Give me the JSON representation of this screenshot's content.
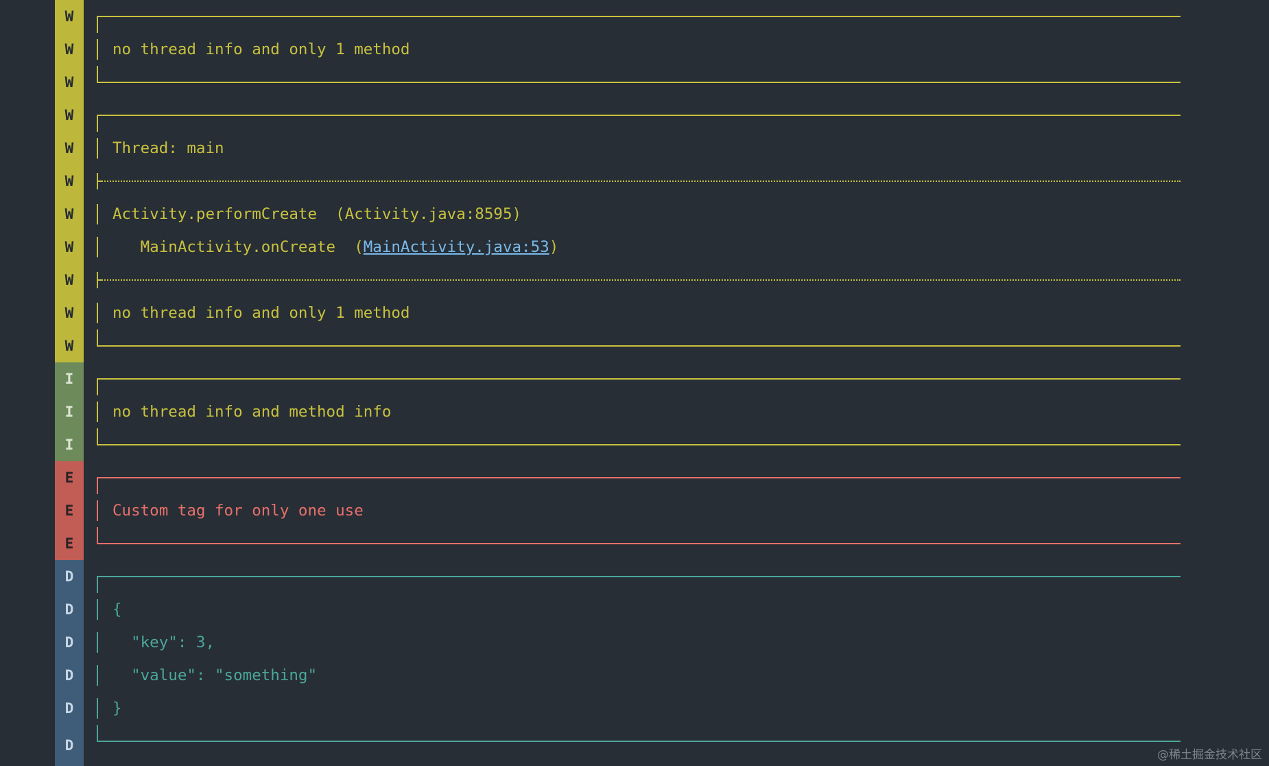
{
  "colors": {
    "warn": "#c8c13e",
    "info": "#6c8a5a",
    "error": "#e8706a",
    "debug": "#4ba69a",
    "link": "#79b9e9",
    "background": "#272e36"
  },
  "levels": [
    "W",
    "W",
    "W",
    "W",
    "W",
    "W",
    "W",
    "W",
    "W",
    "W",
    "W",
    "I",
    "I",
    "I",
    "E",
    "E",
    "E",
    "D",
    "D",
    "D",
    "D",
    "D",
    "D"
  ],
  "lines": [
    {
      "text": "no thread info and only 1 method"
    },
    {
      "text": "Thread: main"
    },
    {
      "text": "Activity.performCreate  (Activity.java:8595)"
    },
    {
      "pre": "   MainActivity.onCreate  (",
      "link": "MainActivity.java:53",
      "post": ")"
    },
    {
      "text": "no thread info and only 1 method"
    },
    {
      "text": "no thread info and method info"
    },
    {
      "text": "Custom tag for only one use"
    },
    {
      "text": "{"
    },
    {
      "text": "  \"key\": 3,"
    },
    {
      "text": "  \"value\": \"something\""
    },
    {
      "text": "}"
    }
  ],
  "watermark": "@稀土掘金技术社区"
}
